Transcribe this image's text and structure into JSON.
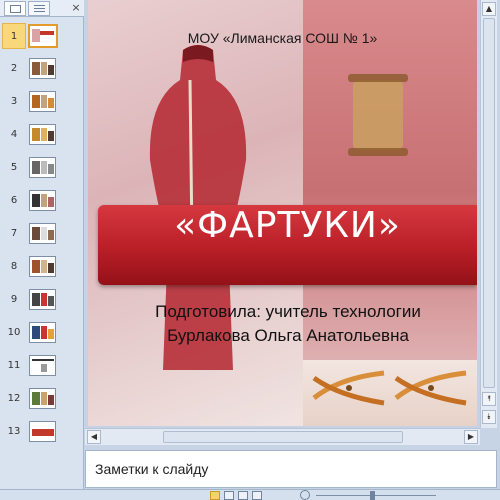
{
  "thumbnail_pane": {
    "tabs": [
      {
        "name": "slides",
        "icon": "slides-tab-icon"
      },
      {
        "name": "outline",
        "icon": "outline-tab-icon"
      }
    ],
    "close_glyph": "×",
    "slides": [
      {
        "number": "1"
      },
      {
        "number": "2"
      },
      {
        "number": "3"
      },
      {
        "number": "4"
      },
      {
        "number": "5"
      },
      {
        "number": "6"
      },
      {
        "number": "7"
      },
      {
        "number": "8"
      },
      {
        "number": "9"
      },
      {
        "number": "10"
      },
      {
        "number": "11"
      },
      {
        "number": "12"
      },
      {
        "number": "13"
      }
    ],
    "selected_slide": "1"
  },
  "slide": {
    "school": "МОУ «Лиманская СОШ № 1»",
    "title": "«ФАРТУКИ»",
    "subtitle_line1": "Подготовила: учитель технологии",
    "subtitle_line2": "Бурлакова Ольга Анатольевна",
    "colors": {
      "banner": "#c62a31",
      "title_text": "#ffffff",
      "background": "#f4ecea"
    }
  },
  "scrollbars": {
    "up_glyph": "▲",
    "prev_slide_glyph": "⯭",
    "next_slide_glyph": "⯯",
    "left_glyph": "◀",
    "right_glyph": "▶"
  },
  "notes": {
    "placeholder": "Заметки к слайду"
  },
  "status_bar": {
    "views": [
      "normal-view-icon",
      "slide-sorter-icon",
      "reading-view-icon",
      "slideshow-icon"
    ]
  }
}
